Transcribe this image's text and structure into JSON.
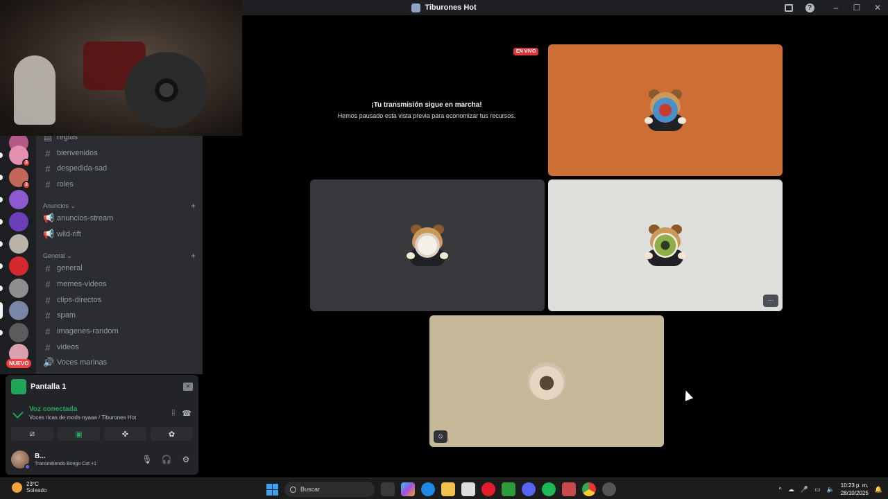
{
  "window": {
    "title": "Tiburones Hot",
    "controls": [
      "minimize",
      "maximize",
      "close"
    ]
  },
  "rail": {
    "badge_counts": [
      "3",
      "3"
    ],
    "nuevo_label": "NUEVO"
  },
  "channels": {
    "top_cut": "reglas",
    "items_top": [
      "bienvenidos",
      "despedida-sad",
      "roles"
    ],
    "category_anuncios": "Anuncios",
    "anuncios": [
      "anuncios-stream",
      "wild-rift"
    ],
    "category_general": "General",
    "general": [
      "general",
      "memes-videos",
      "clips-directos",
      "spam",
      "imagenes-random",
      "videos"
    ],
    "voice_channel": "Voces marinas"
  },
  "voice_panel": {
    "screen_title": "Pantalla 1",
    "status": "Voz conectada",
    "location": "Voces ricas de mods nyaaa / Tiburones Hot"
  },
  "user_panel": {
    "name": "B...",
    "activity": "Transmitiendo Bongo Cat",
    "extra": "+1"
  },
  "stage": {
    "live_label": "EN VIVO",
    "paused_title": "¡Tu transmisión sigue en marcha!",
    "paused_text": "Hemos pausado esta vista previa para economizar tus recursos.",
    "more_label": "···",
    "tile_colors": [
      "#cd6e35",
      "#38383c",
      "#dedfda",
      "#c8b89a"
    ]
  },
  "taskbar": {
    "temperature": "23°C",
    "weather": "Soleado",
    "search_placeholder": "Buscar",
    "time": "10:23 p. m.",
    "date": "28/10/2025"
  }
}
